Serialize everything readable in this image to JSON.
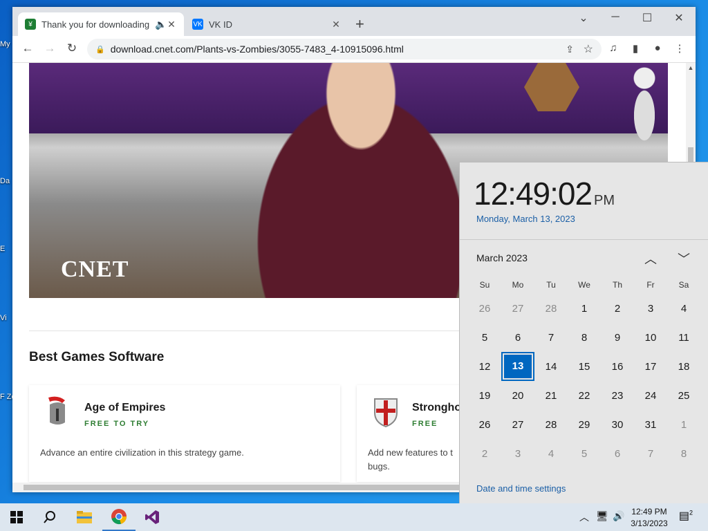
{
  "desktop": {
    "icons": [
      "My",
      "Da",
      "E",
      "Vi",
      "F Zo"
    ]
  },
  "browser": {
    "tabs": [
      {
        "title": "Thank you for downloading",
        "favicon": "cnet-download-favicon",
        "audio": true,
        "active": true
      },
      {
        "title": "VK ID",
        "favicon": "vk-favicon",
        "active": false
      }
    ],
    "new_tab": "+",
    "url": "download.cnet.com/Plants-vs-Zombies/3055-7483_4-10915096.html"
  },
  "page": {
    "video_logo": "CNET",
    "section_title": "Best Games Software",
    "cards": [
      {
        "name": "Age of Empires",
        "license": "FREE TO TRY",
        "description": "Advance an entire civilization in this strategy game.",
        "icon": "spartan-helmet-icon"
      },
      {
        "name": "Strongho",
        "license": "FREE",
        "description": "Add new features to t bugs.",
        "icon": "crusader-shield-icon"
      }
    ]
  },
  "clock": {
    "time": "12:49:02",
    "ampm": "PM",
    "date": "Monday, March 13, 2023",
    "month_label": "March 2023",
    "weekdays": [
      "Su",
      "Mo",
      "Tu",
      "We",
      "Th",
      "Fr",
      "Sa"
    ],
    "weeks": [
      [
        "26",
        "27",
        "28",
        "1",
        "2",
        "3",
        "4"
      ],
      [
        "5",
        "6",
        "7",
        "8",
        "9",
        "10",
        "11"
      ],
      [
        "12",
        "13",
        "14",
        "15",
        "16",
        "17",
        "18"
      ],
      [
        "19",
        "20",
        "21",
        "22",
        "23",
        "24",
        "25"
      ],
      [
        "26",
        "27",
        "28",
        "29",
        "30",
        "31",
        "1"
      ],
      [
        "2",
        "3",
        "4",
        "5",
        "6",
        "7",
        "8"
      ]
    ],
    "dim_cells": [
      [
        0,
        0
      ],
      [
        0,
        1
      ],
      [
        0,
        2
      ],
      [
        4,
        6
      ],
      [
        5,
        0
      ],
      [
        5,
        1
      ],
      [
        5,
        2
      ],
      [
        5,
        3
      ],
      [
        5,
        4
      ],
      [
        5,
        5
      ],
      [
        5,
        6
      ]
    ],
    "today_cell": [
      2,
      1
    ],
    "settings_link": "Date and time settings"
  },
  "taskbar": {
    "apps": [
      "start-icon",
      "search-icon",
      "file-explorer-icon",
      "chrome-icon",
      "visual-studio-icon"
    ],
    "time": "12:49 PM",
    "date": "3/13/2023",
    "notifications": "2"
  }
}
